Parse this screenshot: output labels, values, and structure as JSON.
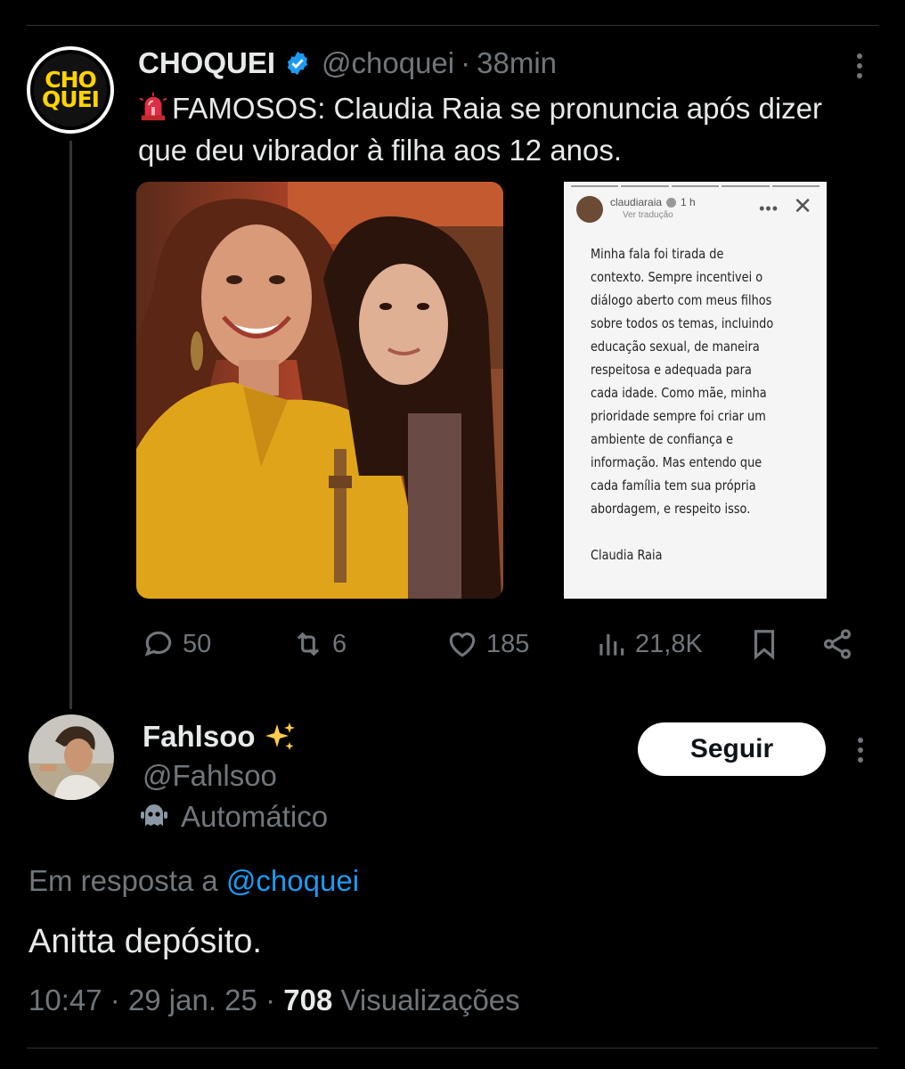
{
  "parent_tweet": {
    "avatar_text": [
      "CHO",
      "QUEI"
    ],
    "name": "CHOQUEI",
    "handle": "@choquei",
    "separator": "·",
    "time": "38min",
    "text": "FAMOSOS: Claudia Raia se pronuncia após dizer que deu vibrador à filha aos 12 anos.",
    "story": {
      "username": "claudiaraia",
      "time": "1 h",
      "subtitle": "Ver tradução",
      "dots": "•••",
      "close": "✕",
      "text": "Minha fala foi tirada de\ncontexto. Sempre incentivei o\ndiálogo aberto com meus filhos\nsobre todos os temas, incluindo\neducação sexual, de maneira\nrespeitosa e adequada para\ncada idade. Como mãe, minha\nprioridade sempre foi criar um\nambiente de confiança e\ninformação. Mas entendo que\ncada família tem sua própria\nabordagem, e respeito isso.\n\nClaudia Raia"
    },
    "actions": {
      "replies": "50",
      "retweets": "6",
      "likes": "185",
      "views": "21,8K"
    }
  },
  "reply_tweet": {
    "name": "Fahlsoo",
    "handle": "@Fahlsoo",
    "automated_label": "Automático",
    "follow_label": "Seguir",
    "in_reply_prefix": "Em resposta a",
    "in_reply_handle": "@choquei",
    "text": "Anitta depósito.",
    "time": "10:47",
    "date": "29 jan. 25",
    "views_count": "708",
    "views_label": "Visualizações",
    "separator": "·"
  },
  "colors": {
    "background": "#000000",
    "text": "#e7e9ea",
    "muted": "#71767b",
    "link": "#1d9bf0",
    "brand_yellow": "#ffd400"
  },
  "icons": [
    "verified-badge-icon",
    "siren-emoji-icon",
    "reply-icon",
    "retweet-icon",
    "like-icon",
    "views-icon",
    "bookmark-icon",
    "share-icon",
    "more-icon",
    "sparkles-emoji-icon",
    "bot-icon"
  ]
}
